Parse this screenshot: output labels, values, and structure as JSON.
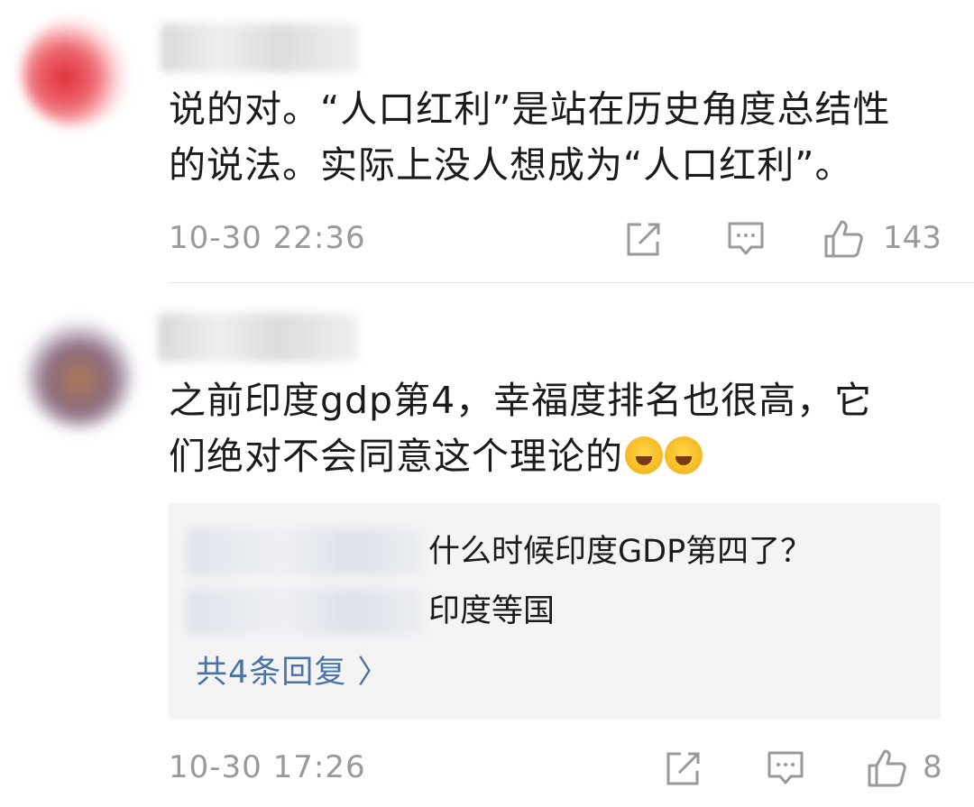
{
  "comments": [
    {
      "text_lines": [
        "说的对。“人口红利”是站在历史角度总结性",
        "的说法。实际上没人想成为“人口红利”。"
      ],
      "timestamp": "10-30 22:36",
      "like_count": "143"
    },
    {
      "text_lines": [
        "之前印度gdp第4，幸福度排名也很高，它",
        "们绝对不会同意这个理论的"
      ],
      "replies": [
        {
          "text": "什么时候印度GDP第四了？"
        },
        {
          "text": "印度等国"
        }
      ],
      "more_replies_label": "共4条回复 〉",
      "timestamp": "10-30 17:26",
      "like_count": "8"
    }
  ],
  "icons": {
    "share": "share-icon",
    "reply": "comment-icon",
    "like": "thumbs-up-icon",
    "emoji": "laughing-crying-emoji-icon"
  },
  "colors": {
    "link": "#4a73a8",
    "meta": "#9a9a9a",
    "reply_bg": "#f4f4f4"
  }
}
